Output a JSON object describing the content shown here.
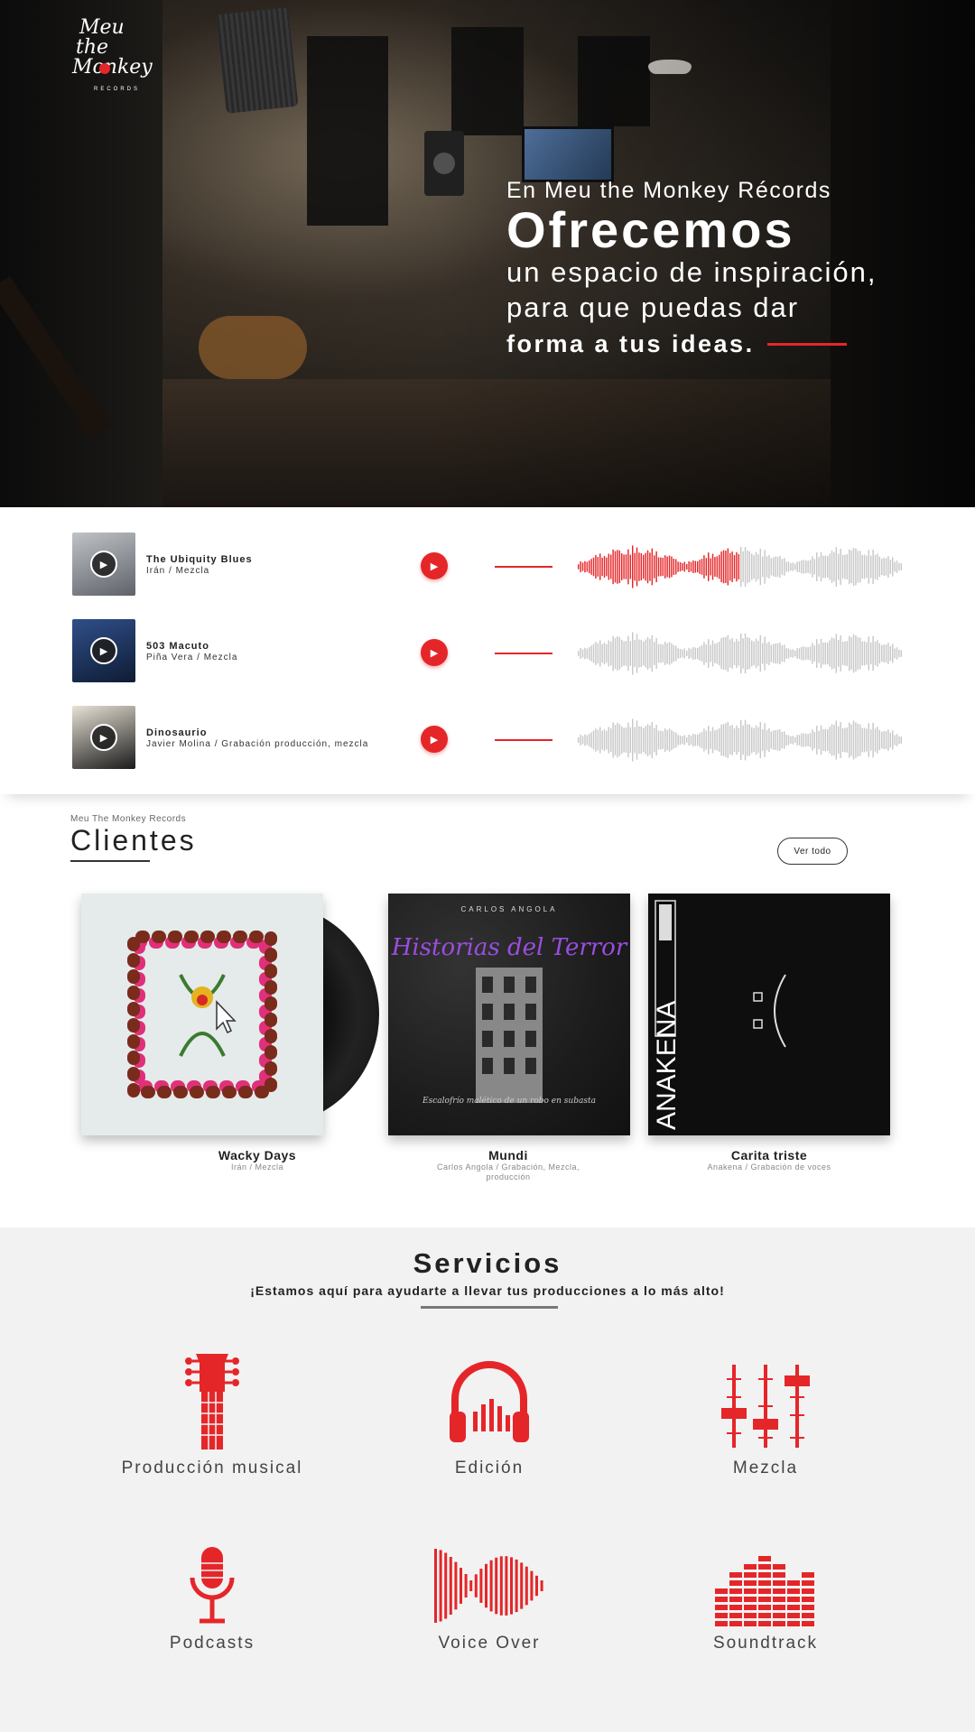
{
  "brand": {
    "logo_line1": "Meu",
    "logo_line2": "the",
    "logo_line3": "Monkey",
    "logo_line4": "RECORDS"
  },
  "hero": {
    "line1": "En Meu the Monkey Récords",
    "line2": "Ofrecemos",
    "line3": "un espacio de inspiración,",
    "line4": "para que puedas dar",
    "line5": "forma a tus ideas."
  },
  "tracks": [
    {
      "title": "The Ubiquity Blues",
      "meta": "Irán / Mezcla",
      "played_fraction": 0.5
    },
    {
      "title": "503 Macuto",
      "meta": "Piña Vera / Mezcla",
      "played_fraction": 0
    },
    {
      "title": "Dinosaurio",
      "meta": "Javier Molina / Grabación producción, mezcla",
      "played_fraction": 0
    }
  ],
  "clientes": {
    "eyebrow": "Meu The Monkey Records",
    "title": "Clientes",
    "see_all": "Ver todo",
    "albums": [
      {
        "title": "Wacky Days",
        "subtitle": "Irán / Mezcla"
      },
      {
        "title": "Mundi",
        "subtitle": "Carlos Angola / Grabación, Mezcla, producción",
        "cover_artist": "CARLOS ANGOLA",
        "cover_title": "Historias del Terror",
        "cover_caption": "Escalofrío malético de un robo en subasta"
      },
      {
        "title": "Carita triste",
        "subtitle": "Anakena / Grabación de voces",
        "cover_artist": "ANAKENA"
      }
    ]
  },
  "servicios": {
    "title": "Servicios",
    "subtitle": "¡Estamos aquí para ayudarte a llevar tus producciones a lo más alto!",
    "items": [
      {
        "label": "Producción musical",
        "icon": "guitar-icon"
      },
      {
        "label": "Edición",
        "icon": "headphones-icon"
      },
      {
        "label": "Mezcla",
        "icon": "mixer-faders-icon"
      },
      {
        "label": "Podcasts",
        "icon": "microphone-icon"
      },
      {
        "label": "Voice Over",
        "icon": "soundwave-icon"
      },
      {
        "label": "Soundtrack",
        "icon": "equalizer-icon"
      }
    ]
  },
  "colors": {
    "accent": "#e52629",
    "waveform_inactive": "#c8c8c8",
    "services_bg": "#f2f2f2"
  }
}
